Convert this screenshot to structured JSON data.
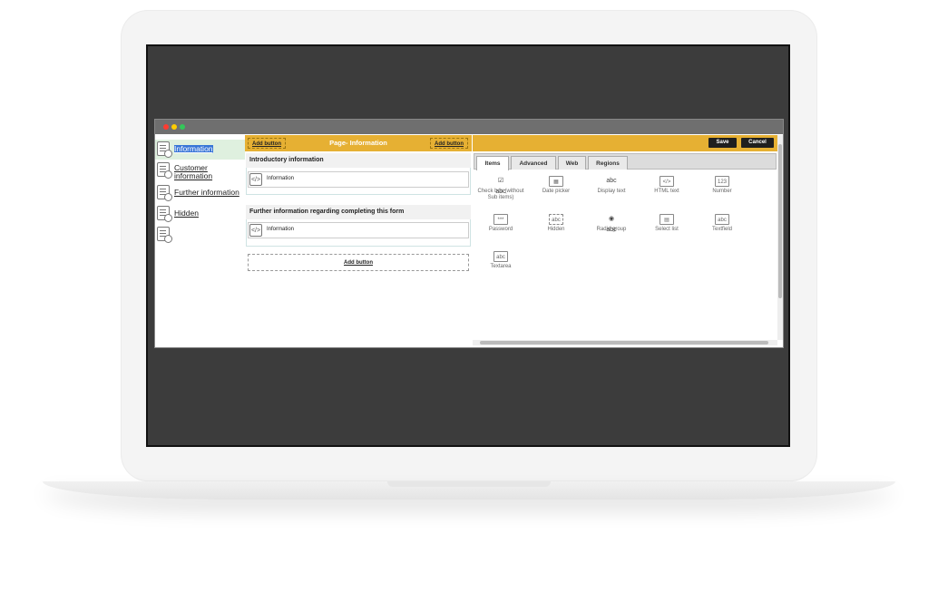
{
  "nav": {
    "items": [
      {
        "label": "Information"
      },
      {
        "label": "Customer information"
      },
      {
        "label": "Further information"
      },
      {
        "label": "Hidden"
      },
      {
        "label": ""
      }
    ]
  },
  "middle": {
    "title": "Page- Information",
    "add_button_left": "Add button",
    "add_button_right": "Add button",
    "sections": [
      {
        "title": "Introductory information",
        "field_label": "Information",
        "field_icon": "</>"
      },
      {
        "title": "Further information regarding completing this form",
        "field_label": "Information",
        "field_icon": "</>"
      }
    ],
    "add_button_bottom": "Add button"
  },
  "right": {
    "save_label": "Save",
    "cancel_label": "Cancel",
    "tabs": [
      {
        "label": "Items"
      },
      {
        "label": "Advanced"
      },
      {
        "label": "Web"
      },
      {
        "label": "Regions"
      }
    ],
    "palette": [
      {
        "icon": "☑ abc",
        "label": "Check box (without Sub items)"
      },
      {
        "icon": "▦",
        "label": "Date picker"
      },
      {
        "icon": "abc",
        "label": "Display text"
      },
      {
        "icon": "</>",
        "label": "HTML text"
      },
      {
        "icon": "123",
        "label": "Number"
      },
      {
        "icon": "***",
        "label": "Password"
      },
      {
        "icon": "abc",
        "label": "Hidden"
      },
      {
        "icon": "◉ abc",
        "label": "Radio group"
      },
      {
        "icon": "▤",
        "label": "Select list"
      },
      {
        "icon": "abc",
        "label": "Textfield"
      },
      {
        "icon": "abc",
        "label": "Textarea"
      }
    ]
  }
}
